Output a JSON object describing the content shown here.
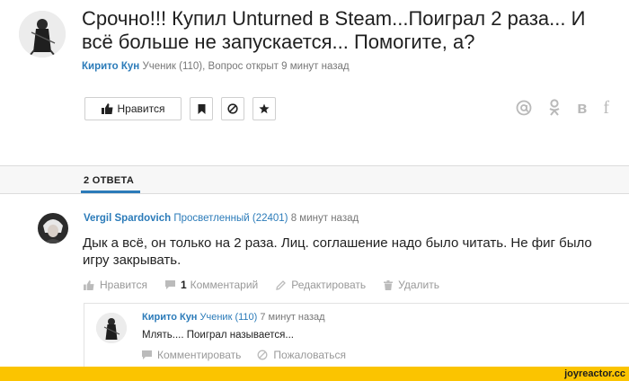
{
  "question": {
    "title": "Срочно!!! Купил Unturned в Steam...Поиграл 2 раза... И всё больше не запускается... Помогите, а?",
    "author": "Кирито Кун",
    "rank": "Ученик (110),",
    "opened": "Вопрос открыт 9 минут назад",
    "like_label": "Нравится",
    "share_icons": [
      "at-icon",
      "odnoklassniki-icon",
      "vk-icon",
      "facebook-icon"
    ],
    "share_glyphs": {
      "vk": "в",
      "facebook": "f"
    }
  },
  "answers_tab": {
    "label": "2 ОТВЕТА"
  },
  "answer": {
    "author": "Vergil Spardovich",
    "rank": "Просветленный (22401)",
    "time": "8 минут назад",
    "text": "Дык а всё, он только на 2 раза. Лиц. соглашение надо было читать. Не фиг было игру закрывать.",
    "like_label": "Нравится",
    "comment_count": "1",
    "comment_label": "Комментарий",
    "edit_label": "Редактировать",
    "delete_label": "Удалить"
  },
  "comment": {
    "author": "Кирито Кун",
    "rank": "Ученик (110)",
    "time": "7 минут назад",
    "text": "Млять.... Поиграл называется...",
    "reply_label": "Комментировать",
    "report_label": "Пожаловаться"
  },
  "watermark": "joyreactor.cc",
  "colors": {
    "link": "#2b7bb9",
    "accent_bar": "#fbc400",
    "muted": "#999999"
  }
}
